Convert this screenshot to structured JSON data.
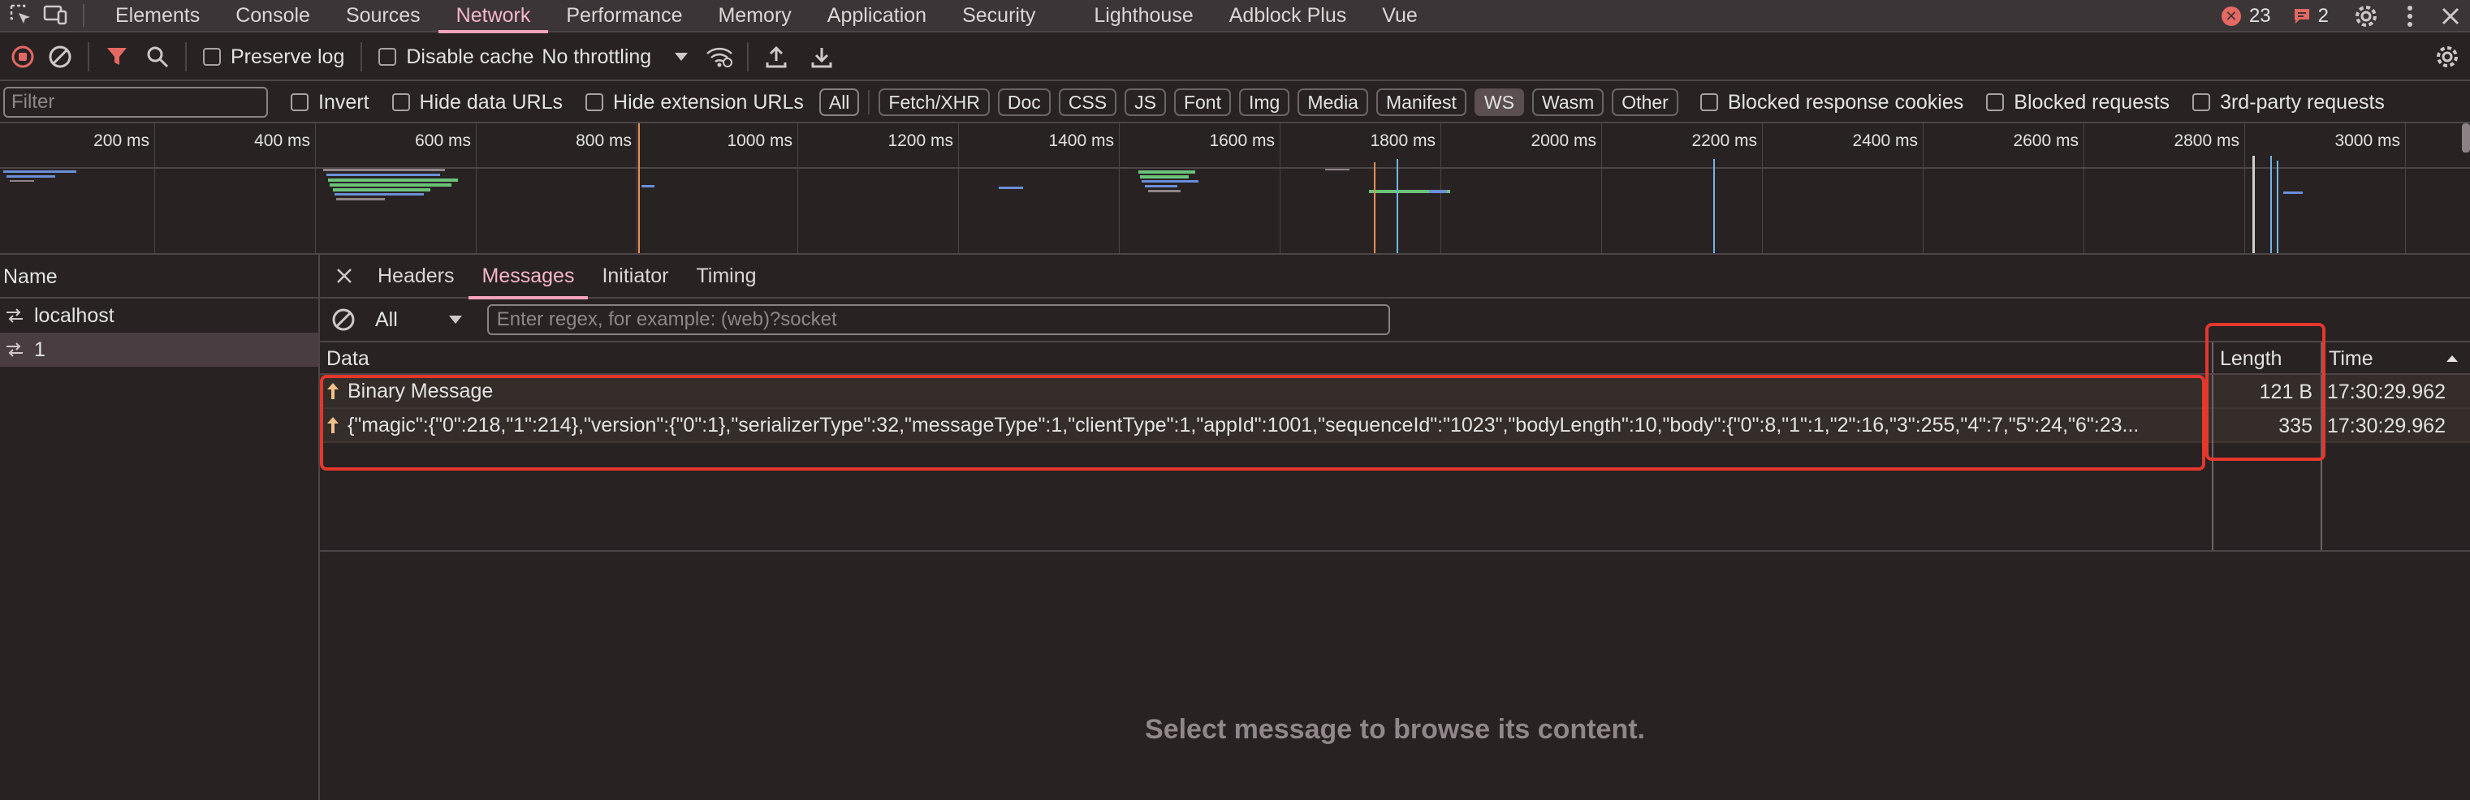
{
  "tabbar": {
    "tabs": [
      "Elements",
      "Console",
      "Sources",
      "Network",
      "Performance",
      "Memory",
      "Application",
      "Security",
      "Lighthouse",
      "Adblock Plus",
      "Vue"
    ],
    "active_tab": "Network",
    "error_count": "23",
    "message_count": "2"
  },
  "toolbar": {
    "preserve_log": "Preserve log",
    "disable_cache": "Disable cache",
    "throttling": "No throttling"
  },
  "filterbar": {
    "placeholder": "Filter",
    "invert": "Invert",
    "hide_data_urls": "Hide data URLs",
    "hide_extension_urls": "Hide extension URLs",
    "types": [
      "All",
      "Fetch/XHR",
      "Doc",
      "CSS",
      "JS",
      "Font",
      "Img",
      "Media",
      "Manifest",
      "WS",
      "Wasm",
      "Other"
    ],
    "active_type": "WS",
    "blocked_cookies": "Blocked response cookies",
    "blocked_requests": "Blocked requests",
    "third_party": "3rd-party requests"
  },
  "overview": {
    "ticks": [
      "200 ms",
      "400 ms",
      "600 ms",
      "800 ms",
      "1000 ms",
      "1200 ms",
      "1400 ms",
      "1600 ms",
      "1800 ms",
      "2000 ms",
      "2200 ms",
      "2400 ms",
      "2600 ms",
      "2800 ms",
      "3000 ms"
    ]
  },
  "namepanel": {
    "header": "Name",
    "items": [
      "localhost",
      "1"
    ]
  },
  "detail": {
    "tabs": [
      "Headers",
      "Messages",
      "Initiator",
      "Timing"
    ],
    "active_tab": "Messages",
    "filter_value": "All",
    "regex_placeholder": "Enter regex, for example: (web)?socket",
    "columns": {
      "data": "Data",
      "length": "Length",
      "time": "Time"
    },
    "messages": [
      {
        "data": "Binary Message",
        "length": "121 B",
        "time": "17:30:29.962"
      },
      {
        "data": "{\"magic\":{\"0\":218,\"1\":214},\"version\":{\"0\":1},\"serializerType\":32,\"messageType\":1,\"clientType\":1,\"appId\":1001,\"sequenceId\":\"1023\",\"bodyLength\":10,\"body\":{\"0\":8,\"1\":1,\"2\":16,\"3\":255,\"4\":7,\"5\":24,\"6\":23...",
        "length": "335",
        "time": "17:30:29.962"
      }
    ],
    "empty_message": "Select message to browse its content."
  },
  "colors": {
    "accent": "#f7a3bd",
    "highlight_box": "#e5372c",
    "record_red": "#e46962"
  }
}
